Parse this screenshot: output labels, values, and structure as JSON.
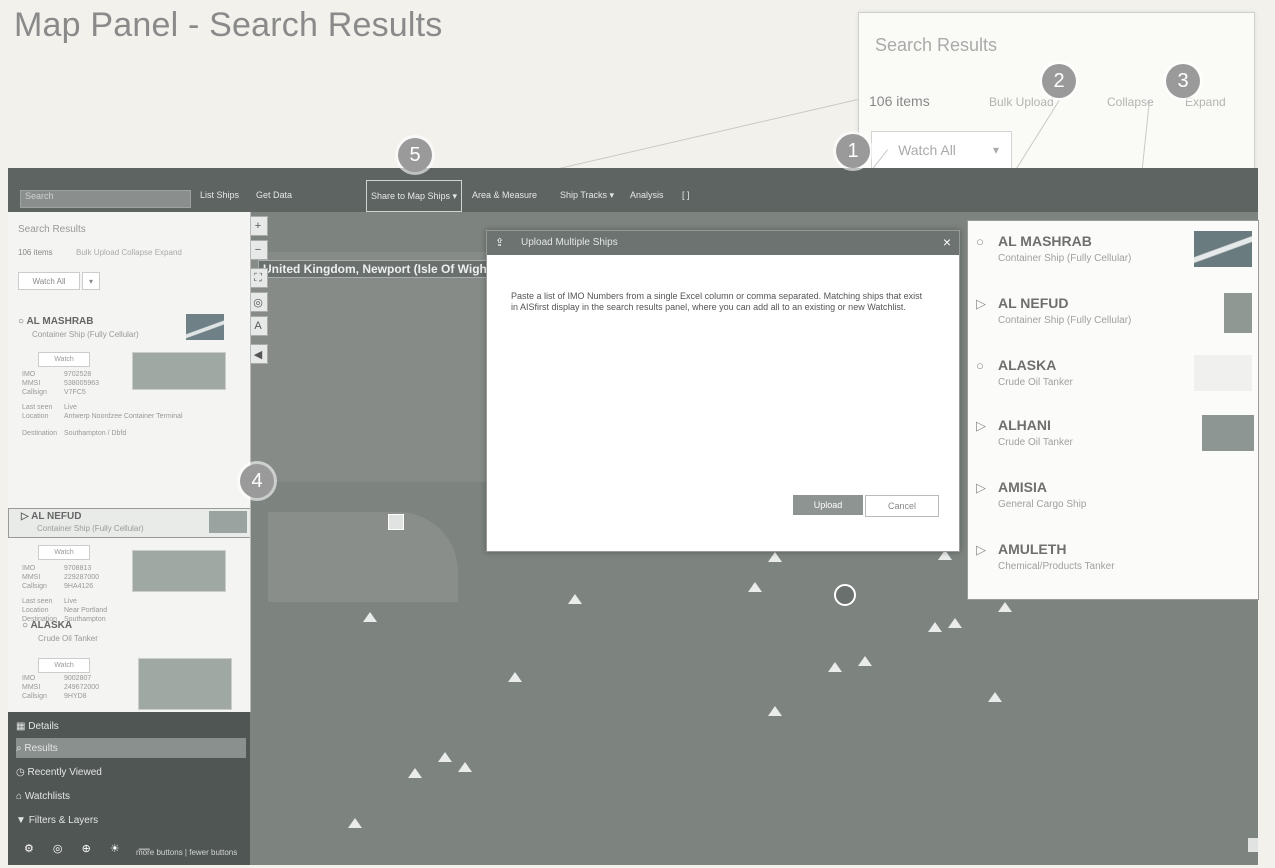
{
  "page_title": "Map Panel - Search Results",
  "zoom": {
    "title": "Search Results",
    "count": "106 items",
    "links": [
      "Bulk Upload",
      "Collapse",
      "Expand"
    ],
    "watch_all": "Watch All",
    "dropdown": "▾"
  },
  "badges": [
    "1",
    "2",
    "3",
    "4",
    "5"
  ],
  "app": {
    "search_placeholder": "Search",
    "toolbar": [
      "List Ships",
      "Get Data",
      "Share to Map Ships ▾",
      "Area & Measure",
      "Ship Tracks ▾",
      "Analysis",
      "[  ]"
    ],
    "location_label": "United Kingdom, Newport (Isle Of Wight)",
    "left_panel": {
      "title": "Search Results",
      "count": "106 items",
      "links": "Bulk Upload Collapse Expand",
      "watch_all": "Watch All",
      "ships": [
        {
          "name": "AL MASHRAB",
          "type": "Container Ship (Fully Cellular)",
          "watch": "Watch",
          "fields": [
            [
              "IMO",
              "9702528"
            ],
            [
              "MMSI",
              "538005963"
            ],
            [
              "Callsign",
              "V7FC5"
            ],
            [
              "Last seen",
              "Live"
            ],
            [
              "Location",
              "Antwerp Noordzee Container Terminal"
            ],
            [
              "Destination",
              "Southampton / Dbfd"
            ]
          ]
        },
        {
          "name": "AL NEFUD",
          "type": "Container Ship (Fully Cellular)",
          "watch": "Watch",
          "fields": [
            [
              "IMO",
              "9708813"
            ],
            [
              "MMSI",
              "229287000"
            ],
            [
              "Callsign",
              "9HA4126"
            ],
            [
              "Last seen",
              "Live"
            ],
            [
              "Location",
              "Near Portland"
            ],
            [
              "Destination",
              "Southampton"
            ]
          ]
        },
        {
          "name": "ALASKA",
          "type": "Crude Oil Tanker",
          "watch": "Watch",
          "fields": [
            [
              "IMO",
              "9002807"
            ],
            [
              "MMSI",
              "249672000"
            ],
            [
              "Callsign",
              "9HYD8"
            ]
          ]
        }
      ]
    },
    "bottom_nav": [
      "Details",
      "Results",
      "Recently Viewed",
      "Watchlists",
      "Filters & Layers"
    ],
    "bottom_icons": "⚙ ◎ ⊕ ☀ —",
    "bottom_footer": "more buttons | fewer buttons",
    "modal": {
      "title": "Upload Multiple Ships",
      "close": "×",
      "body": "Paste a list of IMO Numbers from a single Excel column or comma separated. Matching ships that exist in AISfirst display in the search results panel, where you can add all to an existing or new Watchlist.",
      "upload": "Upload",
      "cancel": "Cancel"
    },
    "results": [
      {
        "name": "AL MASHRAB",
        "type": "Container Ship (Fully Cellular)",
        "mark": "○"
      },
      {
        "name": "AL NEFUD",
        "type": "Container Ship (Fully Cellular)",
        "mark": "▷"
      },
      {
        "name": "ALASKA",
        "type": "Crude Oil Tanker",
        "mark": "○"
      },
      {
        "name": "ALHANI",
        "type": "Crude Oil Tanker",
        "mark": "▷"
      },
      {
        "name": "AMISIA",
        "type": "General Cargo Ship",
        "mark": "▷"
      },
      {
        "name": "AMULETH",
        "type": "Chemical/Products Tanker",
        "mark": "▷"
      }
    ]
  }
}
